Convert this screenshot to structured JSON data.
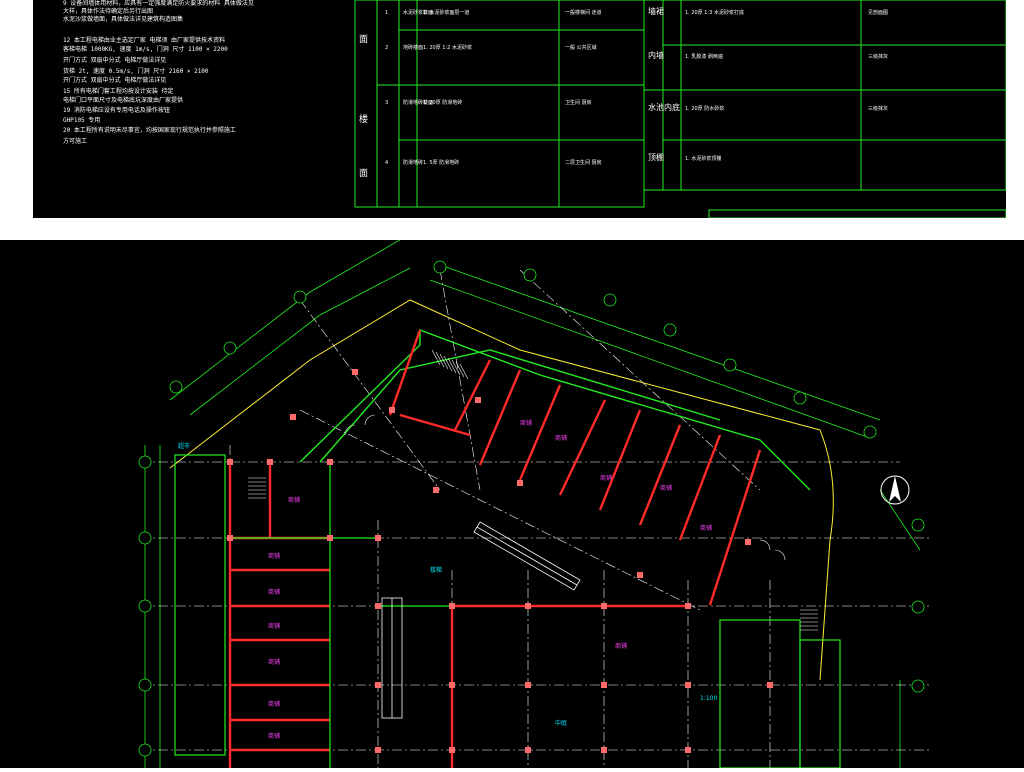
{
  "colors": {
    "background": "#000000",
    "page": "#ffffff",
    "wall": "#ff2a2a",
    "wall_fill": "#ff6a6a",
    "axis_line": "#ffffff",
    "dimension": "#22ee22",
    "grid_bubble": "#22ee22",
    "table_line": "#22ee22",
    "label": "#ff44ff",
    "annotation": "#00e5ff",
    "outline": "#ffee33",
    "note_text": "#ffffff"
  },
  "notes": {
    "lines": [
      "9  设备间墙体用材料，应具有一定强度满足防火要求的材料 具体做法见",
      "   大样，具体作法待确定后另行出图",
      "   水泥沙浆做墙面，具体做法详见建筑构造图集",
      "12  本工程电梯由业主选定厂家 电梯须 由厂家提供技术资料",
      "    客梯电梯  1000KG, 速度 1m/s, 门洞 尺寸  1100 × 2200",
      "            开门方式 双扇中分式 电梯厅做法详见",
      "            货梯  2t, 速度 0.5m/s, 门洞 尺寸 2160 × 2100",
      "            开门方式 双扇中分式 电梯厅做法详见",
      "15  所有电梯门套工程均按设计安装  待定",
      "    电梯门口平面尺寸及电梯底坑深度由厂家提供",
      "19  消防电梯应设有专用电话及操作按钮",
      "    GHP105  专用",
      "20  本工程所有说明未尽事宜，均按国家现行规范执行并参照施工",
      "    方可施工"
    ]
  },
  "materials_table": {
    "left_group_1": "面",
    "left_group_2": "楼",
    "left_group_3": "面",
    "rows": [
      {
        "code": "1",
        "type": "水泥砂浆楼面",
        "spec": "1. 水泥砂浆面层一道",
        "note": "一般楼梯间 走道"
      },
      {
        "code": "2",
        "type": "地砖楼面",
        "spec": "1. 20厚 1:2 水泥砂浆",
        "note": "一般 公共区域"
      },
      {
        "code": "3",
        "type": "防滑地砖楼面",
        "spec": "1. 20厚 防滑地砖",
        "note": "卫生间 厨房"
      },
      {
        "code": "4",
        "type": "防滑地砖",
        "spec": "1. 5厚 防滑地砖",
        "note": "二层卫生间 厨房"
      }
    ],
    "right_rows": [
      {
        "category": "墙裙",
        "spec": "1. 20厚 1:3 水泥砂浆打底",
        "note": "见剖面图"
      },
      {
        "category": "内墙",
        "spec": "1. 乳胶漆 刷两遍",
        "note": "三级抹灰"
      },
      {
        "category": "水池内底",
        "spec": "1. 20厚 防水砂浆",
        "note": "三级抹灰"
      },
      {
        "category": "顶棚",
        "spec": "1. 水泥砂浆顶棚",
        "note": ""
      }
    ]
  },
  "plan": {
    "room_label": "商铺",
    "label_market": "超市",
    "label_stair": "楼梯",
    "label_open": "中庭",
    "label_scale": "1:100"
  }
}
